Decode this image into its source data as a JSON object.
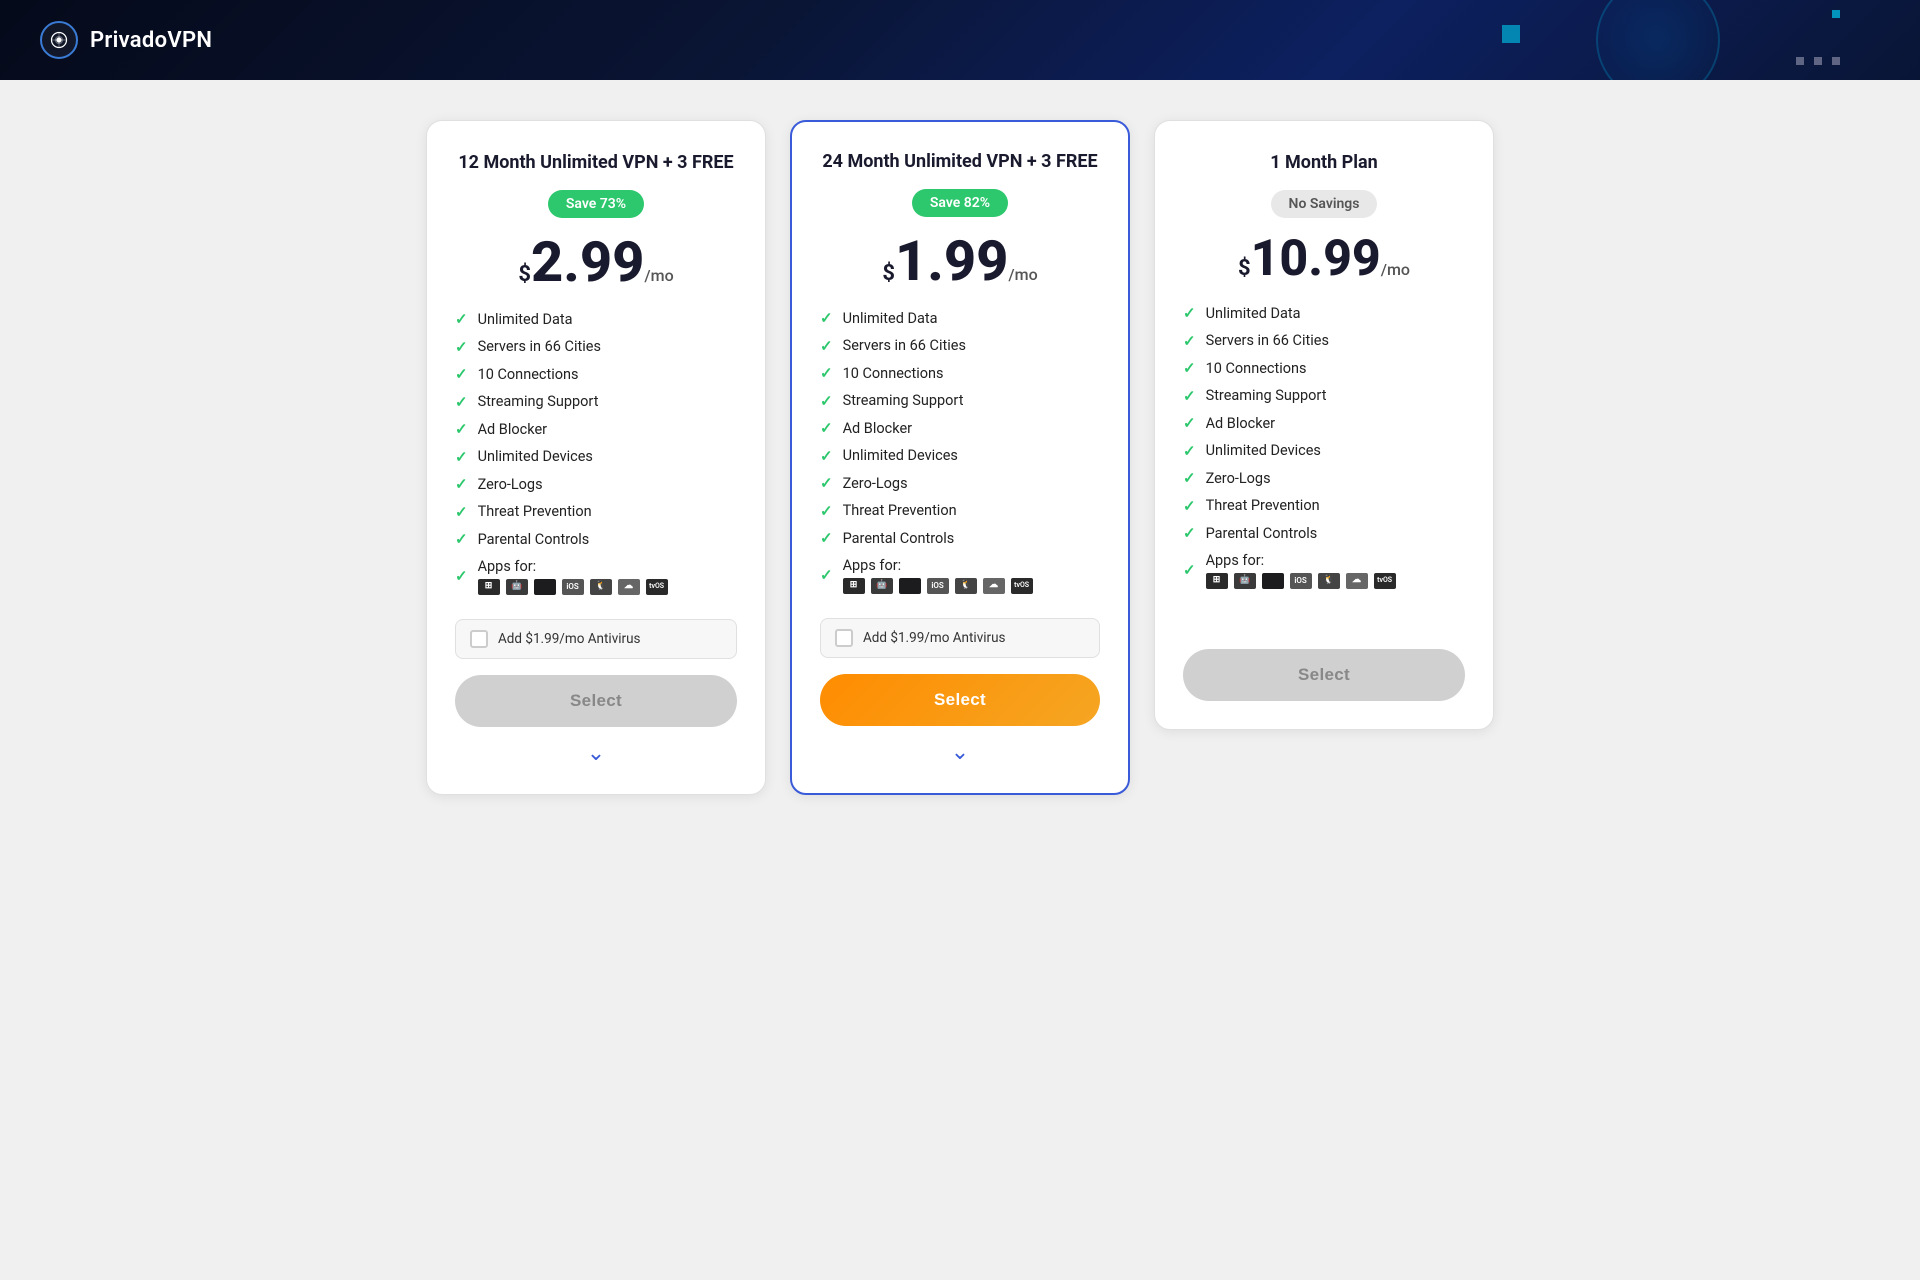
{
  "header": {
    "logo_text": "PrivadoVPN",
    "logo_icon": "shield-lock"
  },
  "plans": [
    {
      "id": "plan-12month",
      "title": "12 Month Unlimited VPN + 3 FREE",
      "savings_badge": "Save 73%",
      "savings_badge_type": "green",
      "price_dollar": "$",
      "price_amount": "2.99",
      "price_period": "/mo",
      "features": [
        "Unlimited Data",
        "Servers in 66 Cities",
        "10 Connections",
        "Streaming Support",
        "Ad Blocker",
        "Unlimited Devices",
        "Zero-Logs",
        "Threat Prevention",
        "Parental Controls"
      ],
      "apps_label": "Apps for:",
      "antivirus_label": "Add $1.99/mo Antivirus",
      "select_label": "Select",
      "select_type": "gray",
      "featured": false
    },
    {
      "id": "plan-24month",
      "title": "24 Month Unlimited VPN + 3 FREE",
      "savings_badge": "Save 82%",
      "savings_badge_type": "green",
      "price_dollar": "$",
      "price_amount": "1.99",
      "price_period": "/mo",
      "features": [
        "Unlimited Data",
        "Servers in 66 Cities",
        "10 Connections",
        "Streaming Support",
        "Ad Blocker",
        "Unlimited Devices",
        "Zero-Logs",
        "Threat Prevention",
        "Parental Controls"
      ],
      "apps_label": "Apps for:",
      "antivirus_label": "Add $1.99/mo Antivirus",
      "select_label": "Select",
      "select_type": "orange",
      "featured": true
    },
    {
      "id": "plan-1month",
      "title": "1 Month Plan",
      "savings_badge": "No Savings",
      "savings_badge_type": "gray",
      "price_dollar": "$",
      "price_amount": "10.99",
      "price_period": "/mo",
      "features": [
        "Unlimited Data",
        "Servers in 66 Cities",
        "10 Connections",
        "Streaming Support",
        "Ad Blocker",
        "Unlimited Devices",
        "Zero-Logs",
        "Threat Prevention",
        "Parental Controls"
      ],
      "apps_label": "Apps for:",
      "antivirus_label": null,
      "select_label": "Select",
      "select_type": "gray",
      "featured": false
    }
  ],
  "app_icons": [
    "W",
    "A",
    "",
    "iOS",
    "L",
    "☁",
    "tvOS"
  ]
}
